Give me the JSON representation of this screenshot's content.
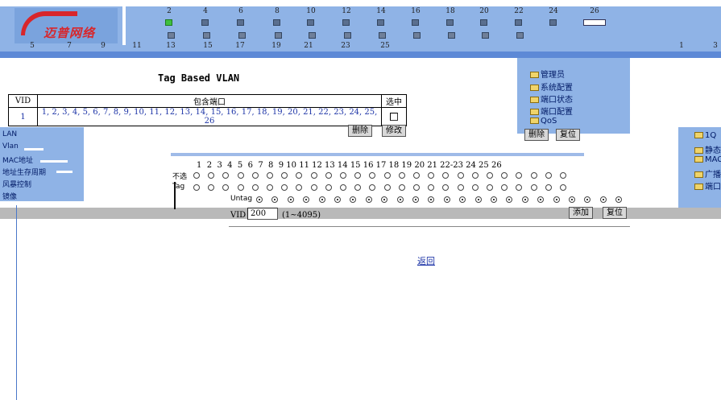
{
  "banner": {
    "logo_text": "",
    "logo_mark": "迈普网络",
    "brand_right": "",
    "top_ports": [
      "2",
      "4",
      "6",
      "8",
      "10",
      "12",
      "14",
      "16",
      "18",
      "20",
      "22",
      "24",
      "26"
    ],
    "bottom_ports": [
      "5",
      "7",
      "9",
      "11",
      "13",
      "15",
      "17",
      "19",
      "21",
      "23",
      "25"
    ],
    "right_ports": [
      "1",
      "3"
    ]
  },
  "left_menu": {
    "items": [
      "LAN",
      "Vlan",
      "MAC地址",
      "地址生存周期",
      "风暴控制",
      "镜像"
    ]
  },
  "right_menu": {
    "items": [
      "管理员",
      "系统配置",
      "端口状态",
      "端口配置",
      "QoS"
    ],
    "btn_a": "删除",
    "btn_b": "复位"
  },
  "edge_menu": {
    "items": [
      "",
      "1Q",
      "静态",
      "MAC",
      "广播",
      "端口"
    ]
  },
  "page": {
    "title": "Tag Based VLAN"
  },
  "vlan_table": {
    "headers": {
      "vid": "VID",
      "ports": "包含端口",
      "select": "选中"
    },
    "rows": [
      {
        "vid": "1",
        "ports": "1, 2, 3, 4, 5, 6, 7, 8, 9, 10, 11, 12, 13, 14, 15, 16, 17, 18, 19, 20, 21, 22, 23, 24, 25, 26",
        "selected": false
      }
    ],
    "delete_label": "删除",
    "modify_label": "修改"
  },
  "matrix": {
    "port_numbers": "1  2  3  4  5  6  7  8  9 10 11 12 13 14 15 16 17 18 19 20 21 22-23 24 25 26",
    "row_a": "不选",
    "row_b": "Tag",
    "row_c": "Untag"
  },
  "vid_form": {
    "label": "VID",
    "value": "200",
    "range": "(1~4095)",
    "add_label": "添加",
    "reset_label": "复位"
  },
  "return_link": "返回",
  "colors": {
    "banner_bg": "#8fb3e6",
    "stripe": "#5d89d6",
    "logo_red": "#d8262b",
    "link_blue": "#2037a8",
    "grey_band": "#b9b9b9"
  }
}
